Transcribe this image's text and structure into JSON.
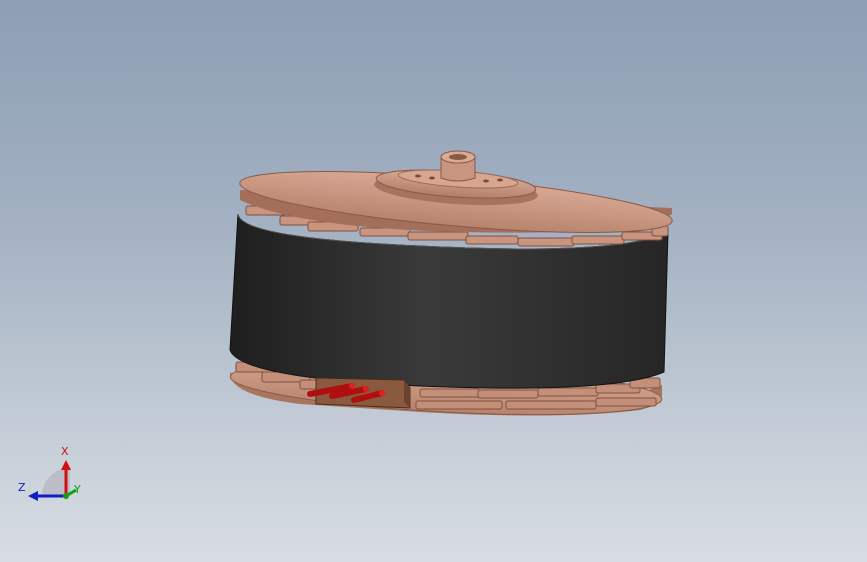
{
  "viewport": {
    "background_top": "#8d9fb4",
    "background_bottom": "#d8dde3"
  },
  "model": {
    "description_icon": "motor-model",
    "colors": {
      "copper": "#c99780",
      "copper_dark": "#9c6a56",
      "band": "#2f2f2f",
      "wire": "#c01010"
    }
  },
  "triad": {
    "x_label": "X",
    "y_label": "Y",
    "z_label": "Z",
    "colors": {
      "x": "#d01010",
      "y": "#10a010",
      "z": "#1020c0"
    }
  }
}
